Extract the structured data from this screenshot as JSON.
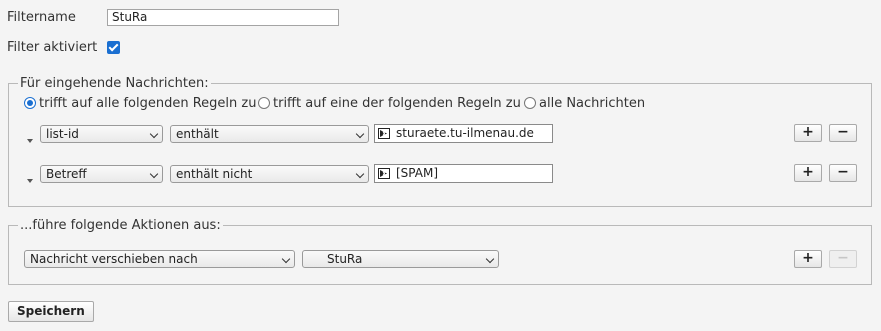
{
  "filter": {
    "name_label": "Filtername",
    "name_value": "StuRa",
    "active_label": "Filter aktiviert",
    "active_checked": true
  },
  "incoming": {
    "legend": "Für eingehende Nachrichten:",
    "match_options": [
      {
        "label": "trifft auf alle folgenden Regeln zu",
        "selected": true
      },
      {
        "label": "trifft auf eine der folgenden Regeln zu",
        "selected": false
      },
      {
        "label": "alle Nachrichten",
        "selected": false
      }
    ],
    "rules": [
      {
        "field": "list-id",
        "operator": "enthält",
        "value": "sturaete.tu-ilmenau.de"
      },
      {
        "field": "Betreff",
        "operator": "enthält nicht",
        "value": "[SPAM]"
      }
    ]
  },
  "actions": {
    "legend": "...führe folgende Aktionen aus:",
    "items": [
      {
        "action": "Nachricht verschieben nach",
        "target": "StuRa"
      }
    ]
  },
  "buttons": {
    "add": "+",
    "remove": "−",
    "save": "Speichern"
  },
  "colors": {
    "accent": "#1a6fd1",
    "background": "#f4f4f4",
    "border": "#b9b9b9"
  }
}
